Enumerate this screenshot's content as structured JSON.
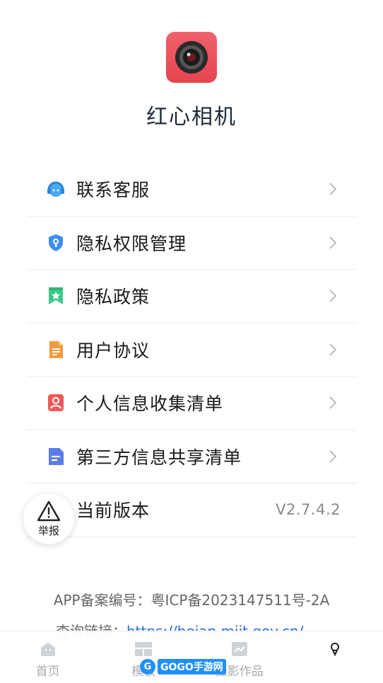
{
  "app": {
    "name": "红心相机"
  },
  "menu": [
    {
      "label": "联系客服",
      "icon": "customer-service-icon",
      "color": "#4aa8f0"
    },
    {
      "label": "隐私权限管理",
      "icon": "shield-key-icon",
      "color": "#3e8ef0"
    },
    {
      "label": "隐私政策",
      "icon": "bookmark-star-icon",
      "color": "#3cc98a"
    },
    {
      "label": "用户协议",
      "icon": "document-icon",
      "color": "#f59a3c"
    },
    {
      "label": "个人信息收集清单",
      "icon": "person-card-icon",
      "color": "#ee5a5a"
    },
    {
      "label": "第三方信息共享清单",
      "icon": "list-document-icon",
      "color": "#5b7be8"
    },
    {
      "label": "当前版本",
      "value": "V2.7.4.2"
    }
  ],
  "report": {
    "label": "举报"
  },
  "footer": {
    "icp": "APP备案编号：粤ICP备2023147511号-2A",
    "query_label": "查询链接：",
    "query_link": "https://beian.miit.gov.cn/"
  },
  "tabs": [
    {
      "label": "首页",
      "icon": "home-icon"
    },
    {
      "label": "模板",
      "icon": "template-grid-icon"
    },
    {
      "label": "摄影作品",
      "icon": "gallery-icon"
    },
    {
      "label": "",
      "icon": "user-icon",
      "active": true
    }
  ],
  "watermark": {
    "text": "GOGO手游网"
  }
}
